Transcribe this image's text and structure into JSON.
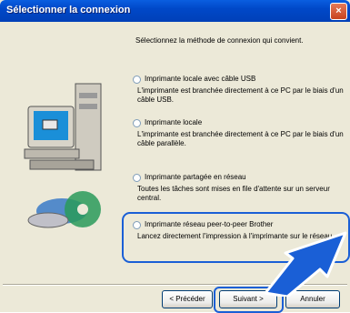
{
  "window": {
    "title": "Sélectionner la connexion",
    "close_glyph": "×"
  },
  "instruction": "Sélectionnez la méthode de connexion qui convient.",
  "options": [
    {
      "label": "Imprimante locale avec câble USB",
      "description": "L'imprimante est branchée directement à ce PC par le biais d'un câble USB.",
      "selected": false
    },
    {
      "label": "Imprimante locale",
      "description": "L'imprimante est branchée directement à ce PC par le biais d'un câble parallèle.",
      "selected": false
    },
    {
      "label": "Imprimante partagée en réseau",
      "description": "Toutes les tâches sont mises en file d'attente sur un serveur central.",
      "selected": false
    },
    {
      "label": "Imprimante réseau peer-to-peer Brother",
      "description": "Lancez directement l'impression à l'imprimante sur le réseau.",
      "selected": false
    }
  ],
  "buttons": {
    "back": "< Précéder",
    "next": "Suivant >",
    "cancel": "Annuler"
  },
  "colors": {
    "title_bar": "#0054e3",
    "highlight": "#1a5fd6",
    "dialog_bg": "#ece9d8"
  }
}
